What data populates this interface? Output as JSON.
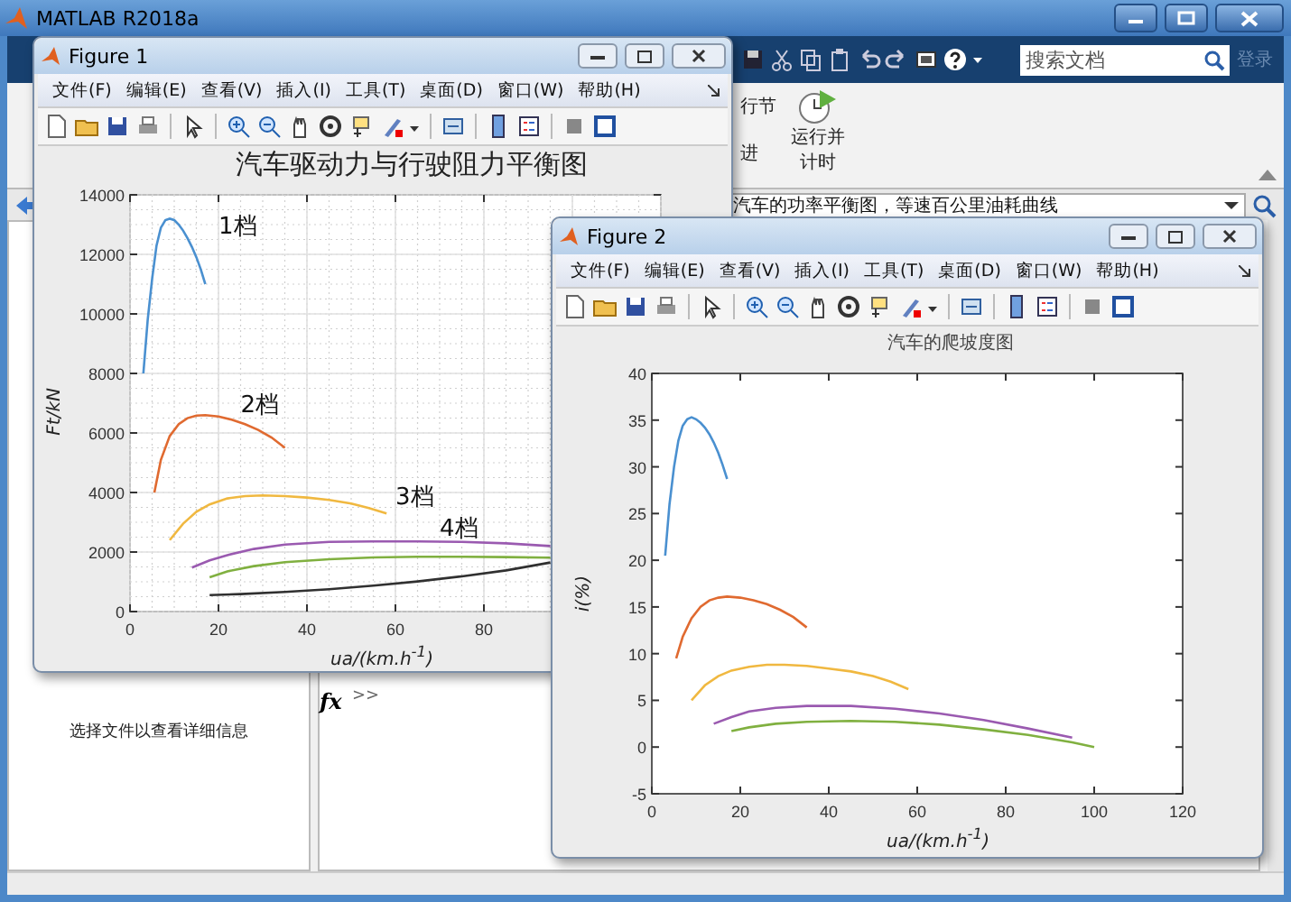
{
  "main_window": {
    "title": "MATLAB R2018a"
  },
  "search": {
    "placeholder": "搜索文档"
  },
  "login": "登录",
  "ribbon": {
    "items": [
      "行节",
      "进"
    ],
    "run_timed": "运行并计时"
  },
  "path_bar": {
    "value": "汽车的功率平衡图，等速百公里油耗曲线"
  },
  "details_panel": {
    "message": "选择文件以查看详细信息"
  },
  "command_window": {
    "fx": "fx",
    "prompt": ">>"
  },
  "figures": [
    {
      "title": "Figure 1",
      "menu": [
        "文件(F)",
        "编辑(E)",
        "查看(V)",
        "插入(I)",
        "工具(T)",
        "桌面(D)",
        "窗口(W)",
        "帮助(H)"
      ],
      "gear_labels": [
        "1档",
        "2档",
        "3档",
        "4档"
      ],
      "chart_data": {
        "type": "line",
        "grid": true,
        "title": "汽车驱动力与行驶阻力平衡图",
        "xlabel": "ua/(km.h$^{-1}$)",
        "ylabel": "Ft/kN",
        "xlim": [
          0,
          120
        ],
        "ylim": [
          0,
          14000
        ],
        "xticks": [
          0,
          20,
          40,
          60,
          80
        ],
        "yticks": [
          0,
          2000,
          4000,
          6000,
          8000,
          10000,
          12000,
          14000
        ],
        "series": [
          {
            "color": "#4a90d0",
            "x": [
              3,
              4,
              5,
              6,
              7,
              8,
              9,
              10,
              11,
              12,
              13,
              14,
              15,
              16,
              17
            ],
            "values": [
              8000,
              9800,
              11200,
              12300,
              12900,
              13150,
              13200,
              13150,
              13000,
              12800,
              12550,
              12250,
              11900,
              11500,
              11000
            ]
          },
          {
            "color": "#e06a30",
            "x": [
              5.5,
              7,
              9,
              11,
              13,
              15,
              17,
              20,
              23,
              26,
              29,
              32,
              35
            ],
            "values": [
              4000,
              5100,
              5900,
              6300,
              6500,
              6580,
              6600,
              6550,
              6450,
              6300,
              6100,
              5850,
              5500
            ]
          },
          {
            "color": "#f0b840",
            "x": [
              9,
              12,
              15,
              18,
              22,
              26,
              30,
              35,
              40,
              45,
              50,
              54,
              58
            ],
            "values": [
              2400,
              2950,
              3350,
              3600,
              3800,
              3880,
              3900,
              3880,
              3830,
              3750,
              3630,
              3480,
              3300
            ]
          },
          {
            "color": "#9a5ab0",
            "x": [
              14,
              18,
              22,
              28,
              35,
              45,
              55,
              65,
              75,
              85,
              95
            ],
            "values": [
              1480,
              1720,
              1900,
              2100,
              2250,
              2340,
              2360,
              2360,
              2340,
              2290,
              2200
            ]
          },
          {
            "color": "#80b040",
            "x": [
              18,
              22,
              28,
              35,
              45,
              55,
              65,
              75,
              85,
              95
            ],
            "values": [
              1150,
              1350,
              1530,
              1660,
              1760,
              1820,
              1840,
              1840,
              1830,
              1810
            ]
          },
          {
            "color": "#303030",
            "x": [
              18,
              25,
              35,
              45,
              55,
              65,
              75,
              85,
              95
            ],
            "values": [
              550,
              590,
              660,
              750,
              870,
              1010,
              1180,
              1380,
              1650
            ]
          }
        ]
      }
    },
    {
      "title": "Figure 2",
      "menu": [
        "文件(F)",
        "编辑(E)",
        "查看(V)",
        "插入(I)",
        "工具(T)",
        "桌面(D)",
        "窗口(W)",
        "帮助(H)"
      ],
      "chart_data": {
        "type": "line",
        "title": "汽车的爬坡度图",
        "xlabel": "ua/(km.h$^{-1}$)",
        "ylabel": "i(%)",
        "xlim": [
          0,
          120
        ],
        "ylim": [
          -5,
          40
        ],
        "xticks": [
          0,
          20,
          40,
          60,
          80,
          100,
          120
        ],
        "yticks": [
          -5,
          0,
          5,
          10,
          15,
          20,
          25,
          30,
          35,
          40
        ],
        "series": [
          {
            "color": "#4a90d0",
            "x": [
              3,
              4,
              5,
              6,
              7,
              8,
              9,
              10,
              11,
              12,
              13,
              14,
              15,
              16,
              17
            ],
            "values": [
              20.5,
              26,
              30,
              32.8,
              34.4,
              35.1,
              35.3,
              35.1,
              34.7,
              34.2,
              33.5,
              32.6,
              31.5,
              30.2,
              28.7
            ]
          },
          {
            "color": "#e06a30",
            "x": [
              5.5,
              7,
              9,
              11,
              13,
              15,
              17,
              20,
              23,
              26,
              29,
              32,
              35
            ],
            "values": [
              9.5,
              11.8,
              13.8,
              15,
              15.7,
              16,
              16.1,
              16,
              15.7,
              15.3,
              14.7,
              13.9,
              12.8
            ]
          },
          {
            "color": "#f0b840",
            "x": [
              9,
              12,
              15,
              18,
              22,
              26,
              30,
              35,
              40,
              45,
              50,
              54,
              58
            ],
            "values": [
              5,
              6.6,
              7.6,
              8.2,
              8.6,
              8.8,
              8.8,
              8.7,
              8.4,
              8.1,
              7.6,
              7,
              6.2
            ]
          },
          {
            "color": "#9a5ab0",
            "x": [
              14,
              18,
              22,
              28,
              35,
              45,
              55,
              65,
              75,
              85,
              95
            ],
            "values": [
              2.5,
              3.2,
              3.8,
              4.2,
              4.4,
              4.4,
              4.1,
              3.6,
              2.9,
              2,
              1
            ]
          },
          {
            "color": "#80b040",
            "x": [
              18,
              22,
              28,
              35,
              45,
              55,
              65,
              75,
              85,
              95,
              100
            ],
            "values": [
              1.7,
              2.1,
              2.5,
              2.7,
              2.8,
              2.7,
              2.4,
              1.9,
              1.3,
              0.5,
              0
            ]
          }
        ]
      }
    }
  ]
}
